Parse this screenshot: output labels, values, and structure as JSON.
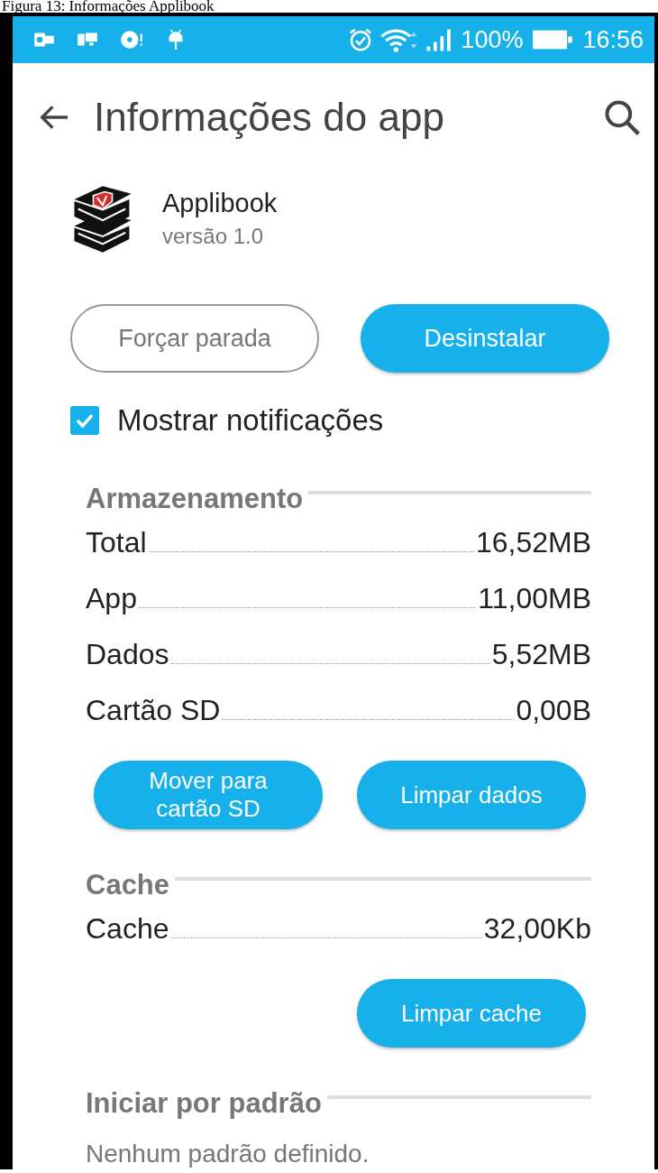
{
  "caption": "Figura 13: Informações Applibook",
  "status_bar": {
    "battery": "100%",
    "time": "16:56"
  },
  "app_bar": {
    "title": "Informações do app"
  },
  "app": {
    "name": "Applibook",
    "version": "versão 1.0"
  },
  "action_buttons": [
    {
      "label": "Forçar parada",
      "kind": "outlined"
    },
    {
      "label": "Desinstalar",
      "kind": "filled"
    }
  ],
  "notifications": {
    "label": "Mostrar notificações",
    "checked": true
  },
  "sections": [
    {
      "title": "Armazenamento",
      "rows": [
        {
          "label": "Total",
          "value": "16,52MB"
        },
        {
          "label": "App",
          "value": "11,00MB"
        },
        {
          "label": "Dados",
          "value": "5,52MB"
        },
        {
          "label": "Cartão SD",
          "value": "0,00B"
        }
      ],
      "buttons": [
        "Mover para cartão SD",
        "Limpar dados"
      ]
    },
    {
      "title": "Cache",
      "rows": [
        {
          "label": "Cache",
          "value": "32,00Kb"
        }
      ],
      "buttons": [
        "Limpar cache"
      ]
    },
    {
      "title": "Iniciar por padrão",
      "description": "Nenhum padrão definido."
    }
  ]
}
